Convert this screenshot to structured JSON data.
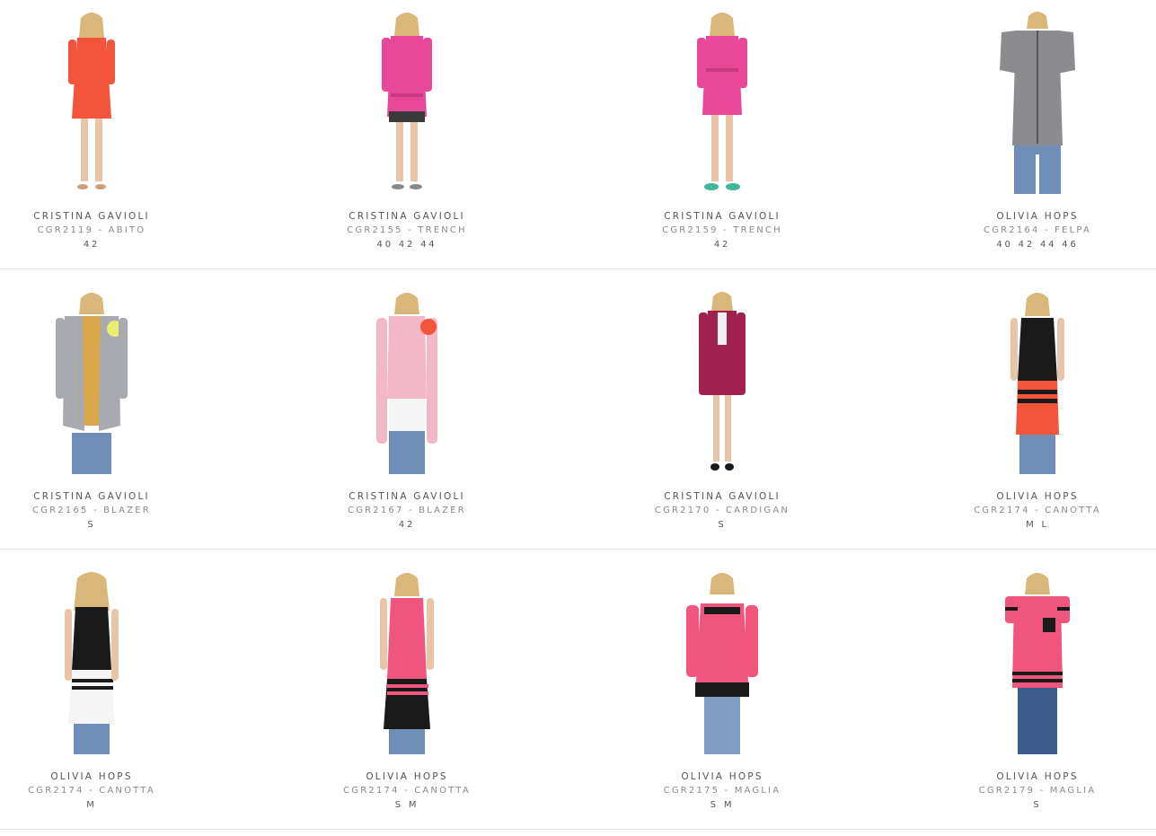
{
  "products": [
    {
      "brand": "CRISTINA GAVIOLI",
      "code": "CGR2119 - ABITO",
      "sizes": "42",
      "icon": "product-photo-dress-coral"
    },
    {
      "brand": "CRISTINA GAVIOLI",
      "code": "CGR2155 - TRENCH",
      "sizes": "40 42 44",
      "icon": "product-photo-trench-pink"
    },
    {
      "brand": "CRISTINA GAVIOLI",
      "code": "CGR2159 - TRENCH",
      "sizes": "42",
      "icon": "product-photo-trench-pink"
    },
    {
      "brand": "OLIVIA HOPS",
      "code": "CGR2164 - FELPA",
      "sizes": "40 42 44 46",
      "icon": "product-photo-hoodie-grey"
    },
    {
      "brand": "CRISTINA GAVIOLI",
      "code": "CGR2165 - BLAZER",
      "sizes": "S",
      "icon": "product-photo-blazer-grey"
    },
    {
      "brand": "CRISTINA GAVIOLI",
      "code": "CGR2167 - BLAZER",
      "sizes": "42",
      "icon": "product-photo-blazer-pink"
    },
    {
      "brand": "CRISTINA GAVIOLI",
      "code": "CGR2170 - CARDIGAN",
      "sizes": "S",
      "icon": "product-photo-cardigan-magenta"
    },
    {
      "brand": "OLIVIA HOPS",
      "code": "CGR2174 - CANOTTA",
      "sizes": "M L",
      "icon": "product-photo-tank-black-red"
    },
    {
      "brand": "OLIVIA HOPS",
      "code": "CGR2174 - CANOTTA",
      "sizes": "M",
      "icon": "product-photo-tank-black-white"
    },
    {
      "brand": "OLIVIA HOPS",
      "code": "CGR2174 - CANOTTA",
      "sizes": "S M",
      "icon": "product-photo-tank-pink-black"
    },
    {
      "brand": "OLIVIA HOPS",
      "code": "CGR2175 - MAGLIA",
      "sizes": "S M",
      "icon": "product-photo-top-pink"
    },
    {
      "brand": "OLIVIA HOPS",
      "code": "CGR2179 - MAGLIA",
      "sizes": "S",
      "icon": "product-photo-tshirt-pink"
    }
  ],
  "colors": {
    "coral": "#f2553a",
    "pink": "#e8489a",
    "hotpink": "#f0557e",
    "magenta": "#a0204f",
    "grey": "#8c8c90",
    "black": "#1a1a1a",
    "denim": "#6f8fb8",
    "skin": "#e8c4a8",
    "hair": "#d9b77a"
  }
}
